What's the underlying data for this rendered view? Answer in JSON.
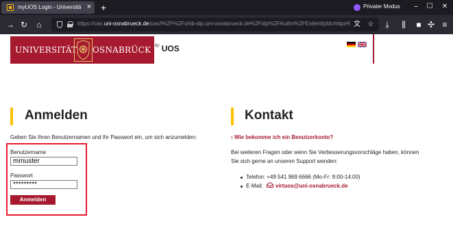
{
  "browser": {
    "tab_title": "myUOS Login - Universität Osna",
    "private_mode_label": "Privater Modus",
    "url_scheme": "https://cas.",
    "url_host": "uni-osnabrueck.de",
    "url_path": "/cas/l",
    "url_query": "%2F%2Fshib-idp.uni-osnabrueck.de%2Fidp%2FAuthn%2FExtentityId=https%"
  },
  "header": {
    "logo_left": "UNIVERSITÄT",
    "logo_right": "OSNABRÜCK",
    "byuos_prefix": "by",
    "byuos_text": "UOS",
    "brand_color": "#a6192e",
    "accent_color": "#ffc000",
    "languages": [
      "de",
      "en"
    ]
  },
  "login": {
    "heading": "Anmelden",
    "intro": "Geben Sie Ihren Benutzernamen und Ihr Passwort ein, um sich anzumelden:",
    "username_label": "Benutzername",
    "username_value": "mmuster",
    "password_label": "Passwort",
    "password_value": "*********",
    "submit_label": "Anmelden",
    "highlight_color": "#e8182d"
  },
  "contact": {
    "heading": "Kontakt",
    "faq_link": "Wie bekomme ich ein Benutzerkonto?",
    "support_line1": "Bei weiteren Fragen oder wenn Sie Verbesserungsvorschläge haben, können",
    "support_line2": "Sie sich gerne an unseren Support wenden:",
    "phone": "Telefon: +49 541 969 6666 (Mo-Fr: 9:00-14:00)",
    "email_label": "E-Mail:",
    "email": "virtuos@uni-osnabrueck.de"
  }
}
